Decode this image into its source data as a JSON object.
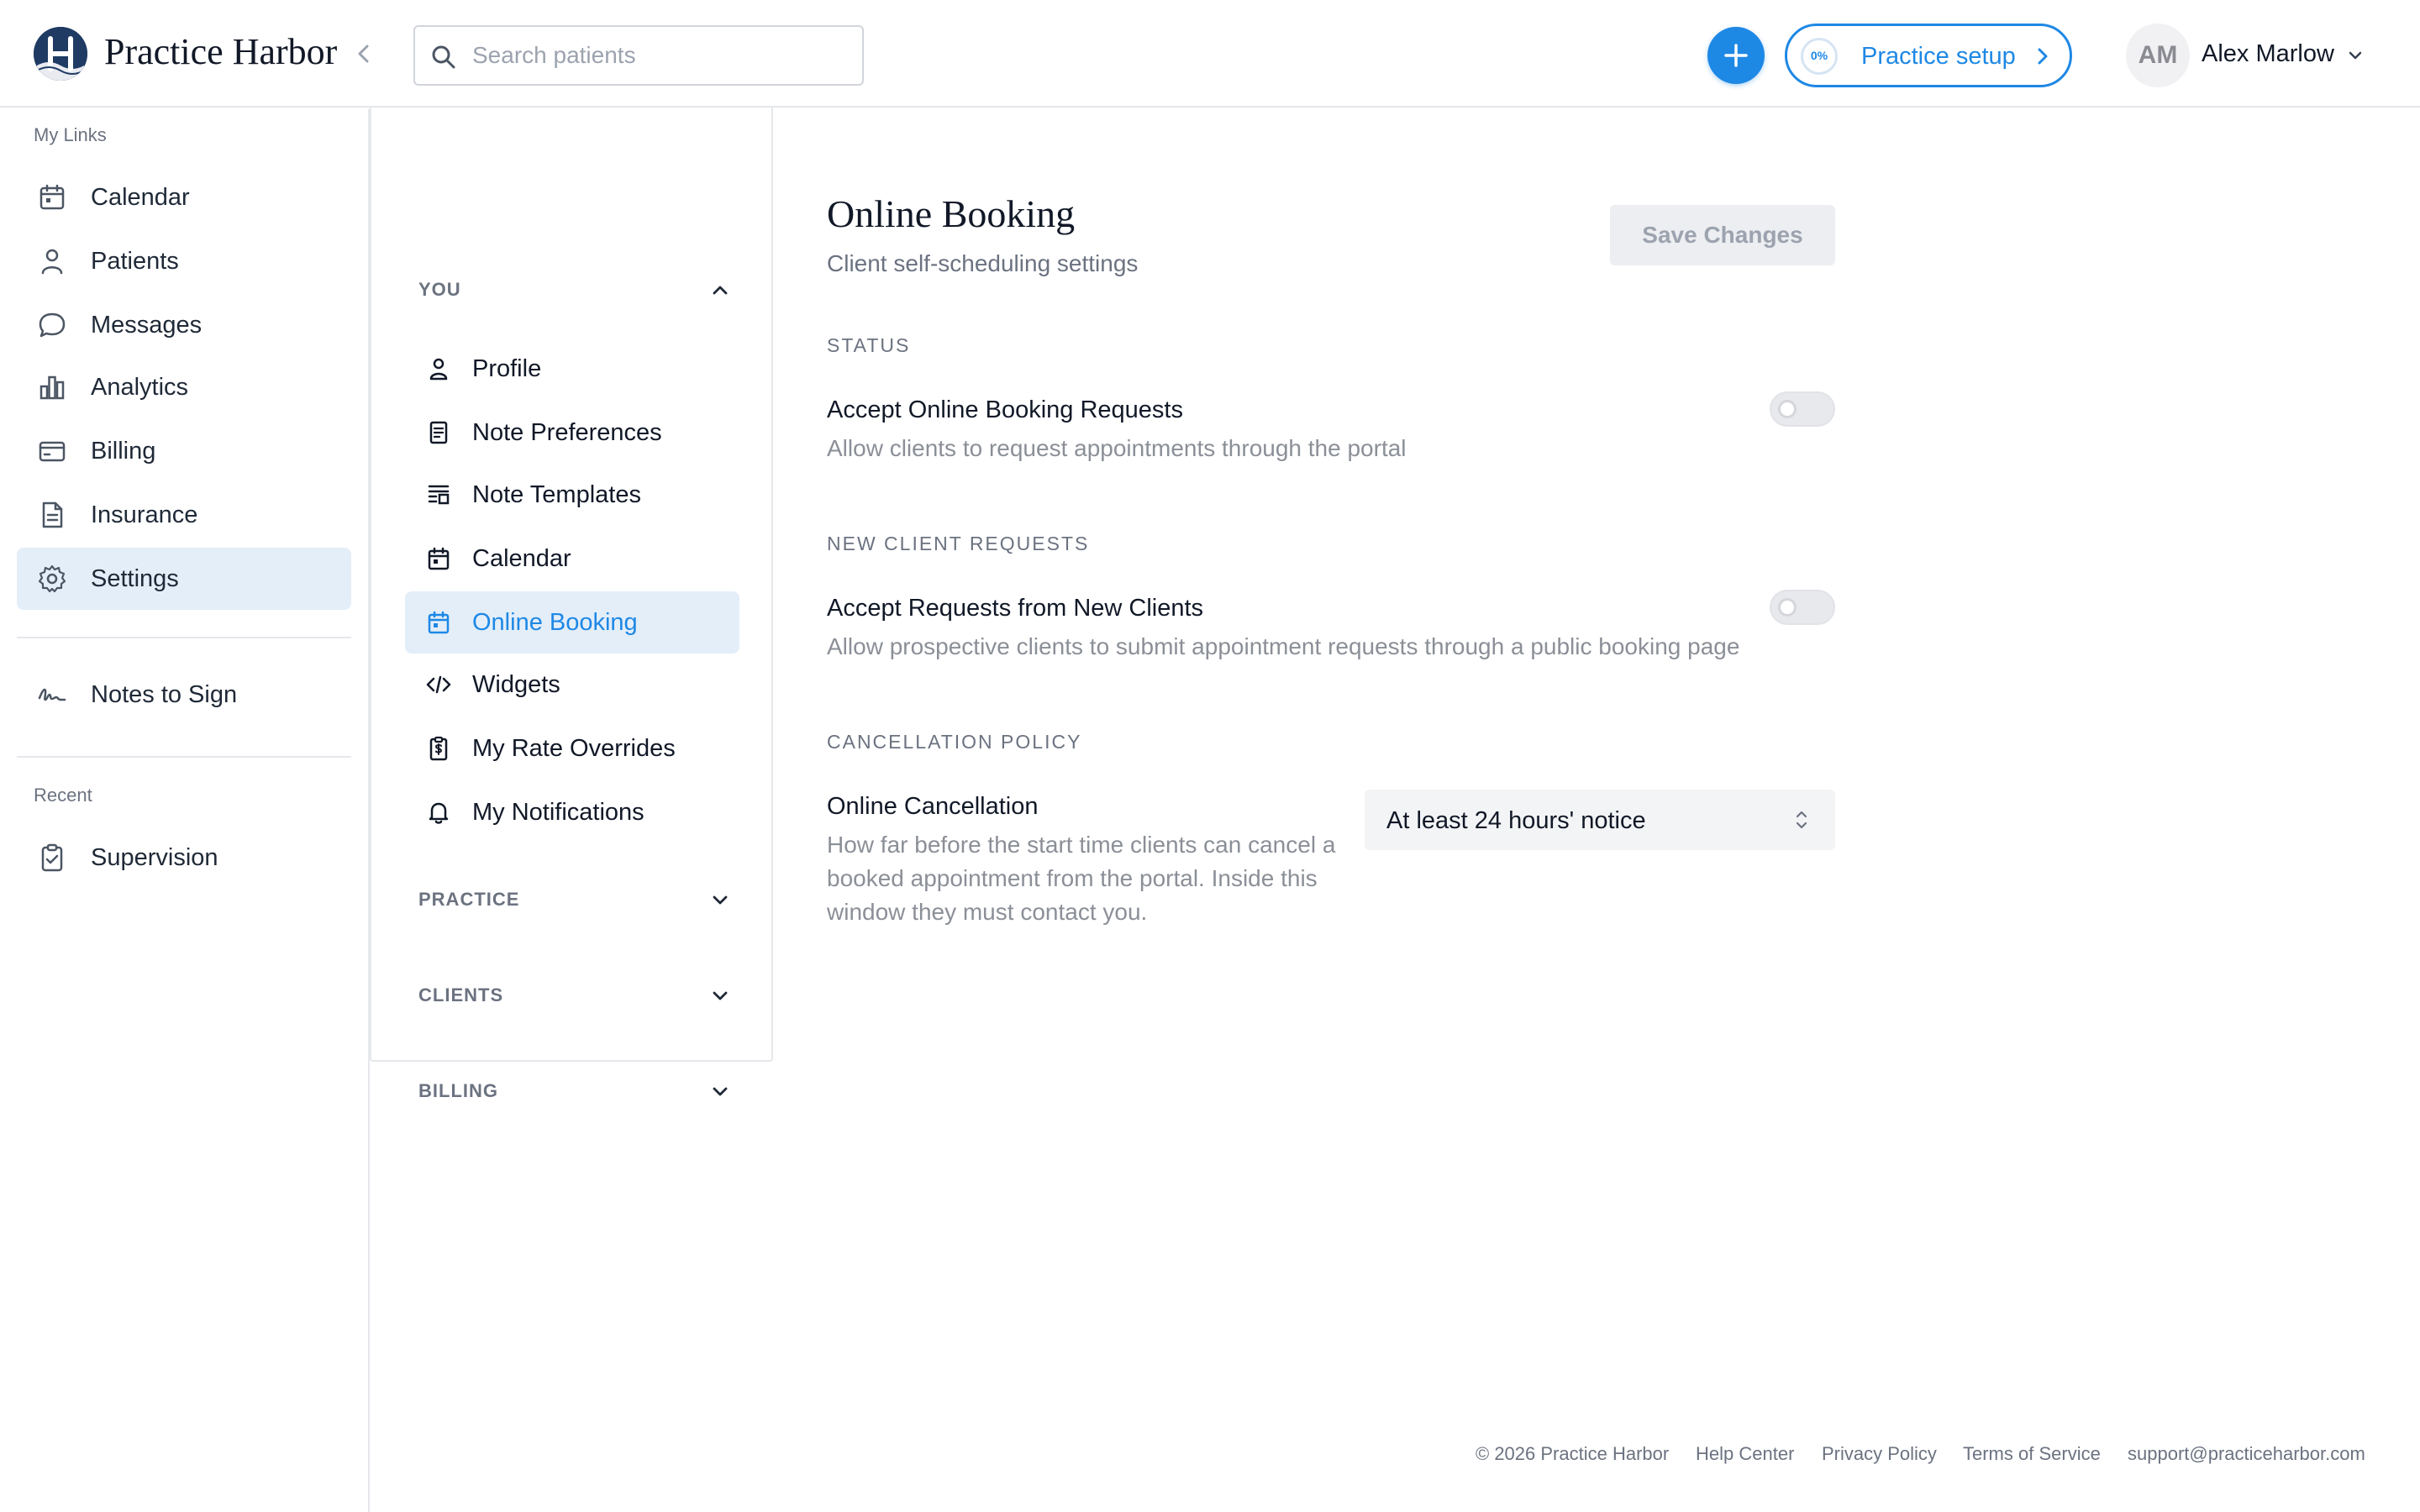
{
  "header": {
    "brand": "Practice Harbor",
    "search_placeholder": "Search patients",
    "setup_label": "Practice setup",
    "setup_progress": "0%",
    "user_initials": "AM",
    "user_name": "Alex Marlow"
  },
  "sidebar": {
    "section_label": "My Links",
    "items": [
      {
        "label": "Calendar",
        "icon": "calendar-icon"
      },
      {
        "label": "Patients",
        "icon": "user-icon"
      },
      {
        "label": "Messages",
        "icon": "chat-bubble-icon"
      },
      {
        "label": "Analytics",
        "icon": "bar-chart-icon"
      },
      {
        "label": "Billing",
        "icon": "credit-card-icon"
      },
      {
        "label": "Insurance",
        "icon": "document-icon"
      },
      {
        "label": "Settings",
        "icon": "gear-icon",
        "active": true
      }
    ],
    "notes_to_sign": "Notes to Sign",
    "recent_label": "Recent",
    "recent_items": [
      {
        "label": "Supervision",
        "icon": "clipboard-check-icon"
      }
    ]
  },
  "settings_nav": {
    "sections": [
      {
        "title": "YOU",
        "expanded": true
      },
      {
        "title": "PRACTICE",
        "expanded": false
      },
      {
        "title": "CLIENTS",
        "expanded": false
      },
      {
        "title": "BILLING",
        "expanded": false
      }
    ],
    "you_items": [
      {
        "label": "Profile",
        "icon": "user-icon"
      },
      {
        "label": "Note Preferences",
        "icon": "note-icon"
      },
      {
        "label": "Note Templates",
        "icon": "template-icon"
      },
      {
        "label": "Calendar",
        "icon": "calendar-icon"
      },
      {
        "label": "Online Booking",
        "icon": "calendar-booking-icon",
        "active": true
      },
      {
        "label": "Widgets",
        "icon": "code-icon"
      },
      {
        "label": "My Rate Overrides",
        "icon": "dollar-clipboard-icon"
      },
      {
        "label": "My Notifications",
        "icon": "bell-icon"
      }
    ]
  },
  "main": {
    "title": "Online Booking",
    "subtitle": "Client self-scheduling settings",
    "save_label": "Save Changes",
    "status": {
      "label": "STATUS",
      "setting_title": "Accept Online Booking Requests",
      "setting_desc": "Allow clients to request appointments through the portal",
      "enabled": false
    },
    "new_clients": {
      "label": "NEW CLIENT REQUESTS",
      "setting_title": "Accept Requests from New Clients",
      "setting_desc": "Allow prospective clients to submit appointment requests through a public booking page",
      "enabled": false
    },
    "cancellation": {
      "label": "CANCELLATION POLICY",
      "setting_title": "Online Cancellation",
      "setting_desc": "How far before the start time clients can cancel a booked appointment from the portal. Inside this window they must contact you.",
      "selected": "At least 24 hours' notice"
    }
  },
  "footer": {
    "copyright": "© 2026 Practice Harbor",
    "help": "Help Center",
    "privacy": "Privacy Policy",
    "terms": "Terms of Service",
    "email": "support@practiceharbor.com"
  },
  "colors": {
    "accent": "#1e88e5",
    "active_bg": "#e3eef9",
    "brand_navy": "#1f3b63",
    "muted_text": "#6b7280"
  }
}
